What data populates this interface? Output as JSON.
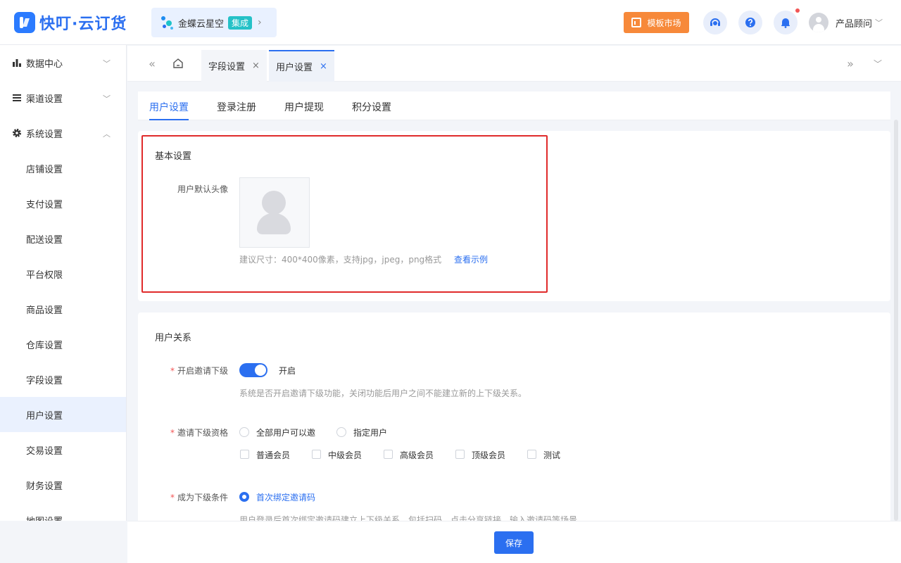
{
  "brand": {
    "name": "快叮·云订货",
    "accent": "#2b6ff0"
  },
  "header": {
    "kingdee": {
      "label": "金蝶云星空",
      "tag": "集成",
      "arrow": "›"
    },
    "market_button": "模板市场",
    "user_name": "产品顾问",
    "user_caret": "﹀"
  },
  "sidebar": {
    "groups": [
      {
        "label": "数据中心",
        "caret": "﹀"
      },
      {
        "label": "渠道设置",
        "caret": "﹀"
      },
      {
        "label": "系统设置",
        "caret": "︿"
      }
    ],
    "items": [
      {
        "label": "店铺设置"
      },
      {
        "label": "支付设置"
      },
      {
        "label": "配送设置"
      },
      {
        "label": "平台权限"
      },
      {
        "label": "商品设置"
      },
      {
        "label": "仓库设置"
      },
      {
        "label": "字段设置"
      },
      {
        "label": "用户设置"
      },
      {
        "label": "交易设置"
      },
      {
        "label": "财务设置"
      },
      {
        "label": "地图设置"
      }
    ]
  },
  "tabbar": {
    "left_arrows": "«",
    "right_arrows": "»",
    "down_caret": "﹀",
    "tabs": [
      {
        "label": "字段设置",
        "close": "×"
      },
      {
        "label": "用户设置",
        "close": "×"
      }
    ]
  },
  "subtabs": [
    "用户设置",
    "登录注册",
    "用户提现",
    "积分设置"
  ],
  "basic": {
    "title": "基本设置",
    "avatar_label": "用户默认头像",
    "hint": "建议尺寸：400*400像素，支持jpg，jpeg，png格式",
    "example_link": "查看示例"
  },
  "relation": {
    "title": "用户关系",
    "invite_label": "开启邀请下级",
    "invite_state": "开启",
    "invite_desc": "系统是否开启邀请下级功能，关闭功能后用户之间不能建立新的上下级关系。",
    "qualify_label": "邀请下级资格",
    "qualify_options": [
      "全部用户可以邀",
      "指定用户"
    ],
    "member_levels": [
      "普通会员",
      "中级会员",
      "高级会员",
      "顶级会员",
      "测试"
    ],
    "condition_label": "成为下级条件",
    "condition_option": "首次绑定邀请码",
    "condition_desc": "用户登录后首次绑定邀请码建立上下级关系，包括扫码、点击分享链接、输入邀请码等场景"
  },
  "footer": {
    "save": "保存"
  }
}
